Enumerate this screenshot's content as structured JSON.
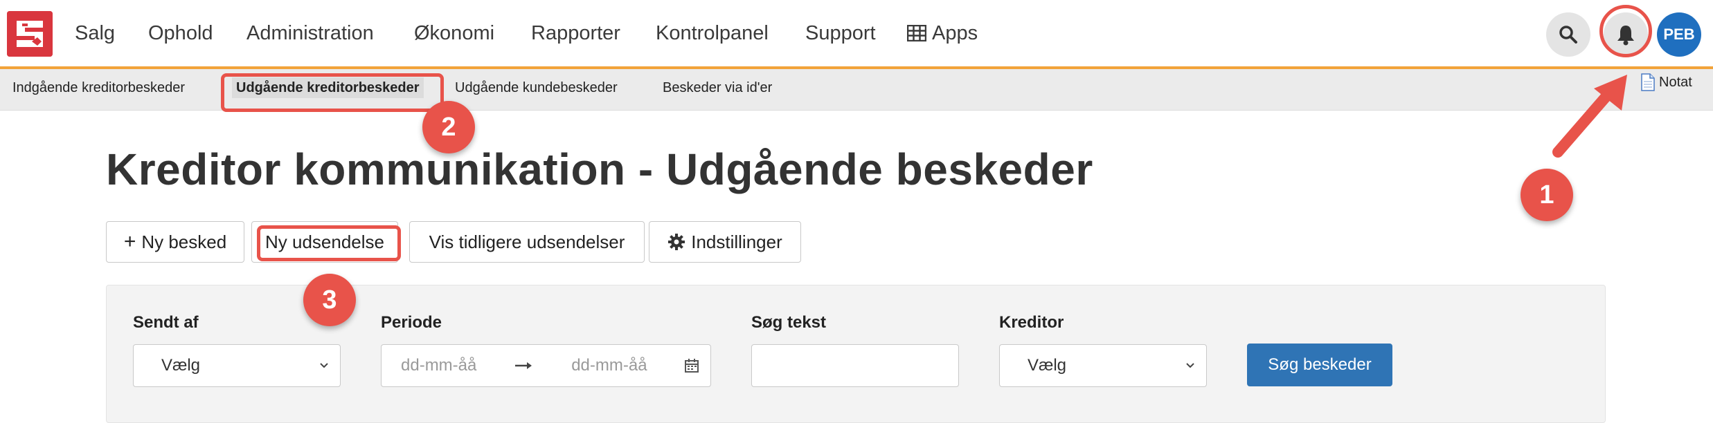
{
  "nav": {
    "items": [
      "Salg",
      "Ophold",
      "Administration",
      "Økonomi",
      "Rapporter",
      "Kontrolpanel",
      "Support"
    ],
    "apps_label": "Apps",
    "user_initials": "PEB"
  },
  "subnav": {
    "items": [
      "Indgående kreditorbeskeder",
      "Udgående kreditorbeskeder",
      "Udgående kundebeskeder",
      "Beskeder via id'er"
    ],
    "notat": "Notat"
  },
  "page": {
    "title": "Kreditor kommunikation - Udgående beskeder"
  },
  "toolbar": {
    "new_message": "Ny besked",
    "new_dispatch": "Ny udsendelse",
    "show_previous": "Vis tidligere udsendelser",
    "settings": "Indstillinger"
  },
  "filters": {
    "sent_by_label": "Sendt af",
    "sent_by_value": "Vælg",
    "period_label": "Periode",
    "date_from_placeholder": "dd-mm-åå",
    "date_to_placeholder": "dd-mm-åå",
    "search_text_label": "Søg tekst",
    "search_text_value": "",
    "creditor_label": "Kreditor",
    "creditor_value": "Vælg",
    "search_button": "Søg beskeder"
  },
  "annotations": {
    "step1": "1",
    "step2": "2",
    "step3": "3"
  },
  "colors": {
    "accent": "#f2a33a",
    "highlight": "#e8534a",
    "primary": "#2f74b5",
    "brand": "#d9363e"
  },
  "icons": [
    "logo-icon",
    "apps-grid-icon",
    "search-icon",
    "bell-icon",
    "document-icon",
    "plus-icon",
    "gear-icon",
    "chevron-down-icon",
    "arrow-right-icon",
    "calendar-icon"
  ]
}
